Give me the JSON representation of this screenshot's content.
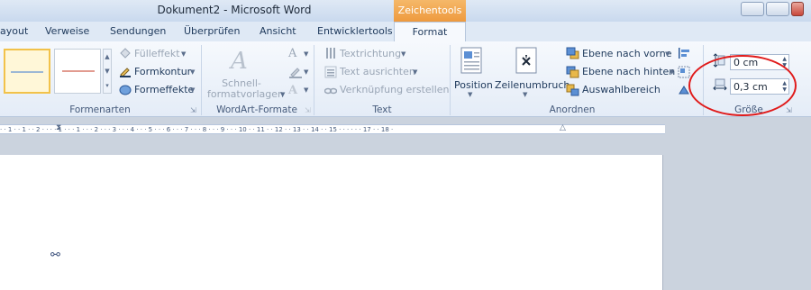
{
  "window": {
    "title": "Dokument2  -  Microsoft Word",
    "contextual_tab_group": "Zeichentools"
  },
  "tabs": [
    "ayout",
    "Verweise",
    "Sendungen",
    "Überprüfen",
    "Ansicht",
    "Entwicklertools"
  ],
  "active_tab": "Format",
  "groups": {
    "formenarten": {
      "label": "Formenarten",
      "fill": "Fülleffekt",
      "outline": "Formkontur",
      "effects": "Formeffekte",
      "style_colors": [
        "#7da4d4",
        "#d97a6b"
      ]
    },
    "wordart": {
      "label": "WordArt-Formate",
      "quick_styles_line1": "Schnell-",
      "quick_styles_line2": "formatvorlagen"
    },
    "text": {
      "label": "Text",
      "direction": "Textrichtung",
      "align": "Text ausrichten",
      "link": "Verknüpfung erstellen"
    },
    "anordnen": {
      "label": "Anordnen",
      "position": "Position",
      "wrap": "Zeilenumbruch",
      "forward": "Ebene nach vorne",
      "backward": "Ebene nach hinten",
      "selection_pane": "Auswahlbereich"
    },
    "groesse": {
      "label": "Größe",
      "height_value": "0 cm",
      "width_value": "0,3 cm"
    }
  },
  "ruler": {
    "text": "· · 1 · · 1 · · 2 · · · · 1 · · · 1 · · · 2 · · · 3 · · · 4 · · · 5 · · · 6 · · · 7 · · · 8 · · · 9 · · · 10 · · 11 · · 12 · · 13 · · 14 · · 15 · · · · · · 17 · · 18 ·"
  },
  "document": {
    "symbol": "⚯"
  },
  "annotation": {
    "color": "#e01b1b"
  }
}
